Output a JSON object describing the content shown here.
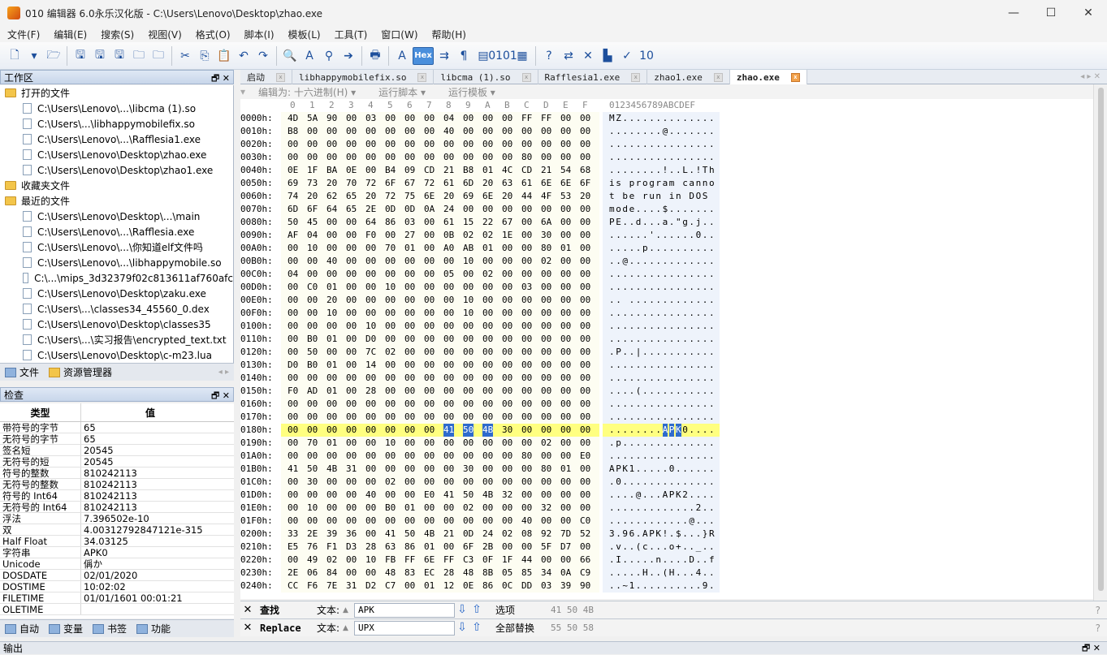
{
  "window": {
    "title": "010 编辑器 6.0永乐汉化版 - C:\\Users\\Lenovo\\Desktop\\zhao.exe",
    "controls": [
      "—",
      "☐",
      "✕"
    ]
  },
  "menu": [
    "文件(F)",
    "编辑(E)",
    "搜索(S)",
    "视图(V)",
    "格式(O)",
    "脚本(I)",
    "模板(L)",
    "工具(T)",
    "窗口(W)",
    "帮助(H)"
  ],
  "toolbar": {
    "hex_label": "Hex",
    "icons": [
      "new-icon",
      "open-icon",
      "save-icon",
      "save-all-icon",
      "save-as-icon",
      "open-folder-icon",
      "folder-icon",
      "cut-icon",
      "copy-icon",
      "paste-icon",
      "undo-icon",
      "redo-icon",
      "find-icon",
      "find-replace-icon",
      "find-in-files-icon",
      "goto-icon",
      "print-icon",
      "font-icon",
      "highlight-icon",
      "hex-icon",
      "wrap-icon",
      "pilcrow-icon",
      "columns-icon",
      "binary-icon",
      "calculator-icon",
      "help-icon",
      "compare-icon",
      "tools-icon",
      "histogram-icon",
      "checksum-icon",
      "base-convert-icon"
    ],
    "glyphs": [
      "🗋",
      "▾",
      "🗁",
      "🖫",
      "🖫",
      "🖫",
      "🗀",
      "🗀",
      "✂",
      "⎘",
      "📋",
      "↶",
      "↷",
      "🔍",
      "A",
      "⚲",
      "➔",
      "🖶",
      "A",
      "⌀",
      "⇉",
      "¶",
      "▤",
      "0101",
      "▦",
      "?",
      "⇄",
      "✕",
      "▙",
      "✓",
      "10"
    ]
  },
  "workspace": {
    "title": "工作区",
    "pin": "🗗",
    "close": "✕",
    "groups": [
      {
        "label": "打开的文件",
        "items": [
          "C:\\Users\\Lenovo\\...\\libcma (1).so",
          "C:\\Users\\...\\libhappymobilefix.so",
          "C:\\Users\\Lenovo\\...\\Rafflesia1.exe",
          "C:\\Users\\Lenovo\\Desktop\\zhao.exe",
          "C:\\Users\\Lenovo\\Desktop\\zhao1.exe"
        ]
      },
      {
        "label": "收藏夹文件",
        "items": []
      },
      {
        "label": "最近的文件",
        "items": [
          "C:\\Users\\Lenovo\\Desktop\\...\\main",
          "C:\\Users\\Lenovo\\...\\Rafflesia.exe",
          "C:\\Users\\Lenovo\\...\\你知道elf文件吗",
          "C:\\Users\\Lenovo\\...\\libhappymobile.so",
          "C:\\...\\mips_3d32379f02c813611af760afc",
          "C:\\Users\\Lenovo\\Desktop\\zaku.exe",
          "C:\\Users\\...\\classes34_45560_0.dex",
          "C:\\Users\\Lenovo\\Desktop\\classes35",
          "C:\\Users\\...\\实习报告\\encrypted_text.txt",
          "C:\\Users\\Lenovo\\Desktop\\c-m23.lua"
        ]
      }
    ],
    "tabs": [
      "文件",
      "资源管理器"
    ],
    "tab_arrows": "◂ ▸"
  },
  "inspector": {
    "title": "检查",
    "col_type": "类型",
    "col_value": "值",
    "rows": [
      [
        "带符号的字节",
        "65"
      ],
      [
        "无符号的字节",
        "65"
      ],
      [
        "签名短",
        "20545"
      ],
      [
        "无符号的短",
        "20545"
      ],
      [
        "符号的整数",
        "810242113"
      ],
      [
        "无符号的整数",
        "810242113"
      ],
      [
        "符号的 Int64",
        "810242113"
      ],
      [
        "无符号的 Int64",
        "810242113"
      ],
      [
        "浮法",
        "7.396502e-10"
      ],
      [
        "双",
        "4.00312792847121e-315"
      ],
      [
        "Half Float",
        "34.03125"
      ],
      [
        "字符串",
        "APK0"
      ],
      [
        "Unicode",
        "偁か"
      ],
      [
        "DOSDATE",
        "02/01/2020"
      ],
      [
        "DOSTIME",
        "10:02:02"
      ],
      [
        "FILETIME",
        "01/01/1601 00:01:21"
      ],
      [
        "OLETIME",
        ""
      ]
    ],
    "tabs": [
      "自动",
      "变量",
      "书签",
      "功能"
    ]
  },
  "editor": {
    "tabs": [
      {
        "label": "启动",
        "active": false
      },
      {
        "label": "libhappymobilefix.so",
        "active": false
      },
      {
        "label": "libcma (1).so",
        "active": false
      },
      {
        "label": "Rafflesia1.exe",
        "active": false
      },
      {
        "label": "zhao1.exe",
        "active": false
      },
      {
        "label": "zhao.exe",
        "active": true
      }
    ],
    "tab_nav": "◂ ▸ ✕",
    "toolbar": [
      "编辑为: 十六进制(H) ▾",
      "运行脚本 ▾",
      "运行模板 ▾"
    ],
    "hex_header": [
      "0",
      "1",
      "2",
      "3",
      "4",
      "5",
      "6",
      "7",
      "8",
      "9",
      "A",
      "B",
      "C",
      "D",
      "E",
      "F"
    ],
    "ascii_header": "0123456789ABCDEF",
    "rows": [
      {
        "addr": "0000h:",
        "hex": "4D 5A 90 00 03 00 00 00 04 00 00 00 FF FF 00 00",
        "ascii": "MZ.............."
      },
      {
        "addr": "0010h:",
        "hex": "B8 00 00 00 00 00 00 00 40 00 00 00 00 00 00 00",
        "ascii": "........@......."
      },
      {
        "addr": "0020h:",
        "hex": "00 00 00 00 00 00 00 00 00 00 00 00 00 00 00 00",
        "ascii": "................"
      },
      {
        "addr": "0030h:",
        "hex": "00 00 00 00 00 00 00 00 00 00 00 00 80 00 00 00",
        "ascii": "................"
      },
      {
        "addr": "0040h:",
        "hex": "0E 1F BA 0E 00 B4 09 CD 21 B8 01 4C CD 21 54 68",
        "ascii": "........!..L.!Th"
      },
      {
        "addr": "0050h:",
        "hex": "69 73 20 70 72 6F 67 72 61 6D 20 63 61 6E 6E 6F",
        "ascii": "is program canno"
      },
      {
        "addr": "0060h:",
        "hex": "74 20 62 65 20 72 75 6E 20 69 6E 20 44 4F 53 20",
        "ascii": "t be run in DOS "
      },
      {
        "addr": "0070h:",
        "hex": "6D 6F 64 65 2E 0D 0D 0A 24 00 00 00 00 00 00 00",
        "ascii": "mode....$......."
      },
      {
        "addr": "0080h:",
        "hex": "50 45 00 00 64 86 03 00 61 15 22 67 00 6A 00 00",
        "ascii": "PE..d...a.\"g.j.."
      },
      {
        "addr": "0090h:",
        "hex": "AF 04 00 00 F0 00 27 00 0B 02 02 1E 00 30 00 00",
        "ascii": "......'......0.."
      },
      {
        "addr": "00A0h:",
        "hex": "00 10 00 00 00 70 01 00 A0 AB 01 00 00 80 01 00",
        "ascii": ".....p.........."
      },
      {
        "addr": "00B0h:",
        "hex": "00 00 40 00 00 00 00 00 00 10 00 00 00 02 00 00",
        "ascii": "..@............."
      },
      {
        "addr": "00C0h:",
        "hex": "04 00 00 00 00 00 00 00 05 00 02 00 00 00 00 00",
        "ascii": "................"
      },
      {
        "addr": "00D0h:",
        "hex": "00 C0 01 00 00 10 00 00 00 00 00 00 03 00 00 00",
        "ascii": "................"
      },
      {
        "addr": "00E0h:",
        "hex": "00 00 20 00 00 00 00 00 00 10 00 00 00 00 00 00",
        "ascii": ".. ............."
      },
      {
        "addr": "00F0h:",
        "hex": "00 00 10 00 00 00 00 00 00 10 00 00 00 00 00 00",
        "ascii": "................"
      },
      {
        "addr": "0100h:",
        "hex": "00 00 00 00 10 00 00 00 00 00 00 00 00 00 00 00",
        "ascii": "................"
      },
      {
        "addr": "0110h:",
        "hex": "00 B0 01 00 D0 00 00 00 00 00 00 00 00 00 00 00",
        "ascii": "................"
      },
      {
        "addr": "0120h:",
        "hex": "00 50 00 00 7C 02 00 00 00 00 00 00 00 00 00 00",
        "ascii": ".P..|..........."
      },
      {
        "addr": "0130h:",
        "hex": "D0 B0 01 00 14 00 00 00 00 00 00 00 00 00 00 00",
        "ascii": "................"
      },
      {
        "addr": "0140h:",
        "hex": "00 00 00 00 00 00 00 00 00 00 00 00 00 00 00 00",
        "ascii": "................"
      },
      {
        "addr": "0150h:",
        "hex": "F0 AD 01 00 28 00 00 00 00 00 00 00 00 00 00 00",
        "ascii": "....(..........."
      },
      {
        "addr": "0160h:",
        "hex": "00 00 00 00 00 00 00 00 00 00 00 00 00 00 00 00",
        "ascii": "................"
      },
      {
        "addr": "0170h:",
        "hex": "00 00 00 00 00 00 00 00 00 00 00 00 00 00 00 00",
        "ascii": "................"
      },
      {
        "addr": "0180h:",
        "hex": "00 00 00 00 00 00 00 00 41 50 4B 30 00 00 00 00",
        "ascii": "........APK0....",
        "highlight": true,
        "sel_start": 8,
        "sel_end": 10
      },
      {
        "addr": "0190h:",
        "hex": "00 70 01 00 00 10 00 00 00 00 00 00 00 02 00 00",
        "ascii": ".p.............."
      },
      {
        "addr": "01A0h:",
        "hex": "00 00 00 00 00 00 00 00 00 00 00 00 80 00 00 E0",
        "ascii": "................"
      },
      {
        "addr": "01B0h:",
        "hex": "41 50 4B 31 00 00 00 00 00 30 00 00 00 80 01 00",
        "ascii": "APK1.....0......"
      },
      {
        "addr": "01C0h:",
        "hex": "00 30 00 00 00 02 00 00 00 00 00 00 00 00 00 00",
        "ascii": ".0.............."
      },
      {
        "addr": "01D0h:",
        "hex": "00 00 00 00 40 00 00 E0 41 50 4B 32 00 00 00 00",
        "ascii": "....@...APK2...."
      },
      {
        "addr": "01E0h:",
        "hex": "00 10 00 00 00 B0 01 00 00 02 00 00 00 32 00 00",
        "ascii": ".............2.."
      },
      {
        "addr": "01F0h:",
        "hex": "00 00 00 00 00 00 00 00 00 00 00 00 40 00 00 C0",
        "ascii": "............@..."
      },
      {
        "addr": "0200h:",
        "hex": "33 2E 39 36 00 41 50 4B 21 0D 24 02 08 92 7D 52",
        "ascii": "3.96.APK!.$...}R"
      },
      {
        "addr": "0210h:",
        "hex": "E5 76 F1 D3 28 63 86 01 00 6F 2B 00 00 5F D7 00",
        "ascii": ".v..(c...o+.._.."
      },
      {
        "addr": "0220h:",
        "hex": "00 49 02 00 10 FB FF 6E FF C3 0F 1F 44 00 00 66",
        "ascii": ".I.....n....D..f"
      },
      {
        "addr": "0230h:",
        "hex": "2E 06 84 00 00 48 83 EC 28 48 8B 05 85 34 0A C9",
        "ascii": ".....H..(H...4.."
      },
      {
        "addr": "0240h:",
        "hex": "CC F6 7E 31 D2 C7 00 01 12 0E 86 0C DD 03 39 90",
        "ascii": "..~1..........9."
      }
    ]
  },
  "find": {
    "find_label": "查找",
    "replace_label": "Replace",
    "text_label": "文本:",
    "find_value": "APK",
    "replace_value": "UPX",
    "options_label": "选项",
    "replace_all_label": "全部替换",
    "find_hex": "41 50 4B",
    "replace_hex": "55 50 58",
    "close": "✕",
    "help": "?"
  },
  "status": {
    "output_label": "输出"
  }
}
